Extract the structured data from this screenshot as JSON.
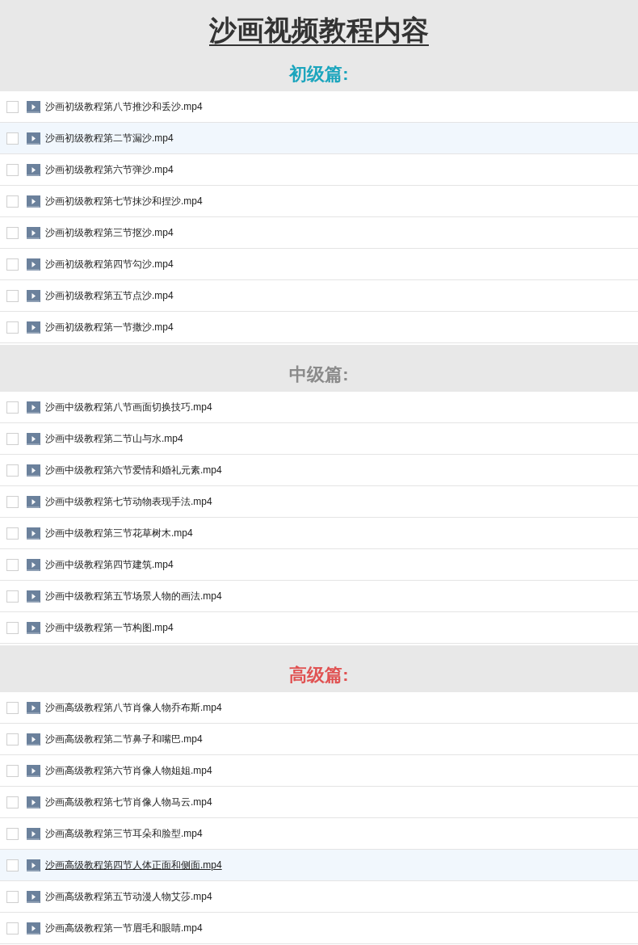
{
  "title": "沙画视频教程内容",
  "sections": [
    {
      "heading": "初级篇:",
      "color": "#1ba5bd",
      "files": [
        {
          "name": "沙画初级教程第八节推沙和丢沙.mp4",
          "checked": false,
          "highlighted": false,
          "underlined": false
        },
        {
          "name": "沙画初级教程第二节漏沙.mp4",
          "checked": false,
          "highlighted": true,
          "underlined": false
        },
        {
          "name": "沙画初级教程第六节弹沙.mp4",
          "checked": false,
          "highlighted": false,
          "underlined": false
        },
        {
          "name": "沙画初级教程第七节抹沙和捏沙.mp4",
          "checked": false,
          "highlighted": false,
          "underlined": false
        },
        {
          "name": "沙画初级教程第三节抠沙.mp4",
          "checked": false,
          "highlighted": false,
          "underlined": false
        },
        {
          "name": "沙画初级教程第四节勾沙.mp4",
          "checked": false,
          "highlighted": false,
          "underlined": false
        },
        {
          "name": "沙画初级教程第五节点沙.mp4",
          "checked": false,
          "highlighted": false,
          "underlined": false
        },
        {
          "name": "沙画初级教程第一节撒沙.mp4",
          "checked": false,
          "highlighted": false,
          "underlined": false
        }
      ]
    },
    {
      "heading": "中级篇:",
      "color": "#8a8a8a",
      "files": [
        {
          "name": "沙画中级教程第八节画面切换技巧.mp4",
          "checked": false,
          "highlighted": false,
          "underlined": false
        },
        {
          "name": "沙画中级教程第二节山与水.mp4",
          "checked": false,
          "highlighted": false,
          "underlined": false
        },
        {
          "name": "沙画中级教程第六节爱情和婚礼元素.mp4",
          "checked": false,
          "highlighted": false,
          "underlined": false
        },
        {
          "name": "沙画中级教程第七节动物表现手法.mp4",
          "checked": false,
          "highlighted": false,
          "underlined": false
        },
        {
          "name": "沙画中级教程第三节花草树木.mp4",
          "checked": false,
          "highlighted": false,
          "underlined": false
        },
        {
          "name": "沙画中级教程第四节建筑.mp4",
          "checked": false,
          "highlighted": false,
          "underlined": false
        },
        {
          "name": "沙画中级教程第五节场景人物的画法.mp4",
          "checked": false,
          "highlighted": false,
          "underlined": false
        },
        {
          "name": "沙画中级教程第一节构图.mp4",
          "checked": false,
          "highlighted": false,
          "underlined": false
        }
      ]
    },
    {
      "heading": "高级篇:",
      "color": "#e05252",
      "files": [
        {
          "name": "沙画高级教程第八节肖像人物乔布斯.mp4",
          "checked": false,
          "highlighted": false,
          "underlined": false
        },
        {
          "name": "沙画高级教程第二节鼻子和嘴巴.mp4",
          "checked": false,
          "highlighted": false,
          "underlined": false
        },
        {
          "name": "沙画高级教程第六节肖像人物姐姐.mp4",
          "checked": false,
          "highlighted": false,
          "underlined": false
        },
        {
          "name": "沙画高级教程第七节肖像人物马云.mp4",
          "checked": false,
          "highlighted": false,
          "underlined": false
        },
        {
          "name": "沙画高级教程第三节耳朵和脸型.mp4",
          "checked": false,
          "highlighted": false,
          "underlined": false
        },
        {
          "name": "沙画高级教程第四节人体正面和侧面.mp4",
          "checked": false,
          "highlighted": true,
          "underlined": true
        },
        {
          "name": "沙画高级教程第五节动漫人物艾莎.mp4",
          "checked": false,
          "highlighted": false,
          "underlined": false
        },
        {
          "name": "沙画高级教程第一节眉毛和眼睛.mp4",
          "checked": false,
          "highlighted": false,
          "underlined": false
        }
      ]
    }
  ]
}
